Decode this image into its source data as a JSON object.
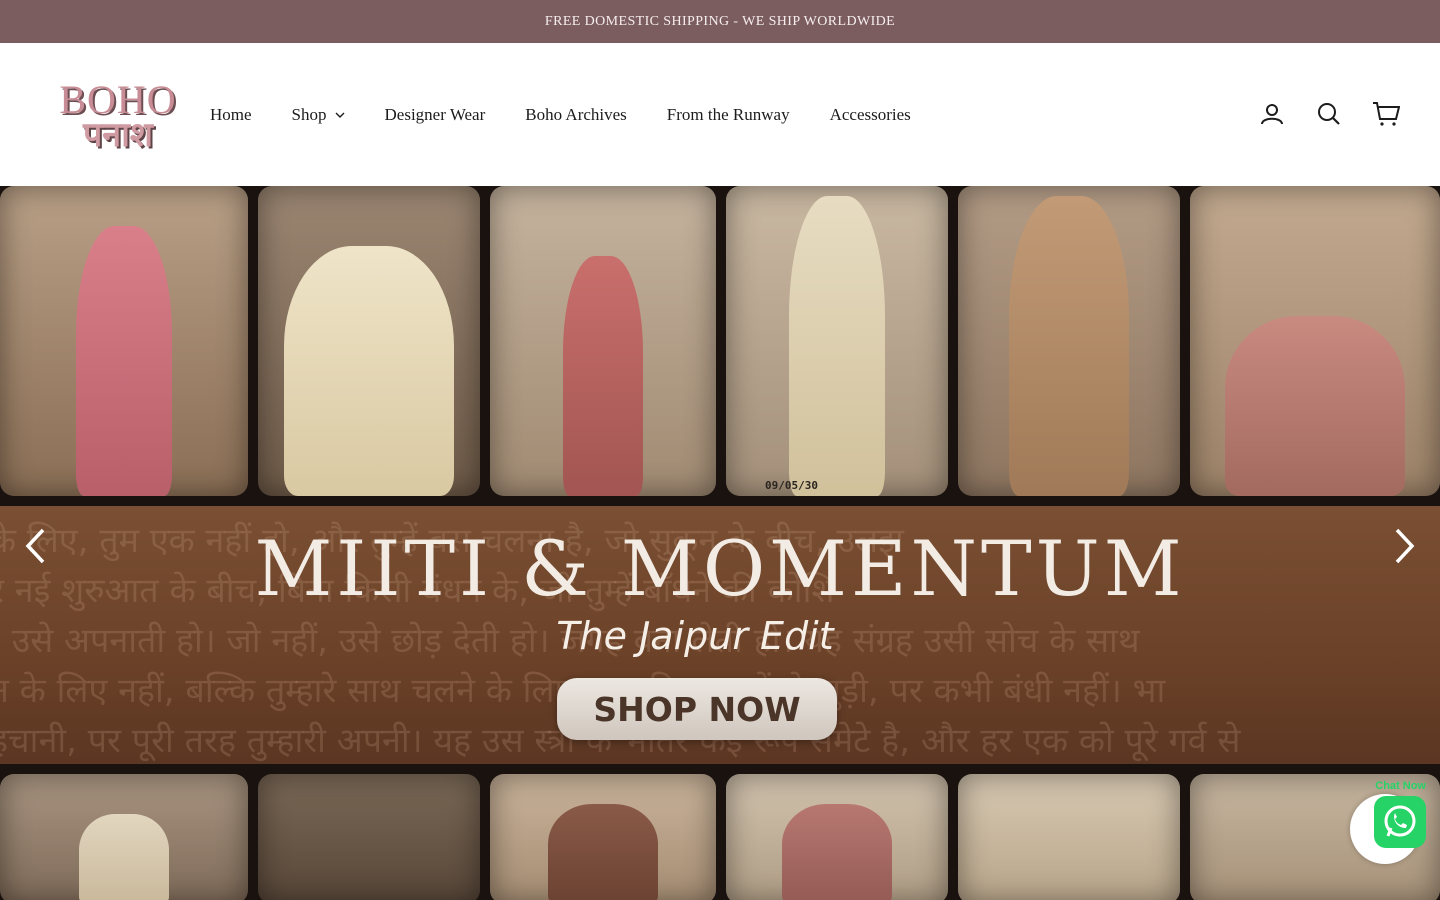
{
  "announcement": "FREE DOMESTIC SHIPPING - WE SHIP WORLDWIDE",
  "brand": {
    "line1": "BOHO",
    "line2": "पनाश"
  },
  "nav": {
    "items": [
      {
        "label": "Home"
      },
      {
        "label": "Shop"
      },
      {
        "label": "Designer Wear"
      },
      {
        "label": "Boho Archives"
      },
      {
        "label": "From the Runway"
      },
      {
        "label": "Accessories"
      }
    ]
  },
  "icons": {
    "account": "account-icon",
    "search": "search-icon",
    "cart": "cart-icon"
  },
  "hero": {
    "headline": "MIITI & MOMENTUM",
    "subheadline": "The Jaipur Edit",
    "cta": "SHOP NOW",
    "date_stamp": "09/05/30",
    "background_text": [
      "के लिए, तुम एक नहीं हो, और तुम्हें बस चलना है, जो सुकून के बीच, उलझ",
      "र नई शुरुआत के बीच, बिना किसी बंधन के, जो तुम्हें बाँधने की कोशि",
      ", उसे अपनाती हो। जो नहीं, उसे छोड़ देती हो। जगह बना लेती हो। यह संग्रह उसी सोच के साथ",
      "न के लिए नहीं, बल्कि तुम्हारे साथ चलने के लिए। उस दिन। जड़ों से जुड़ी, पर कभी बंधी नहीं। भा",
      "हचानी, पर पूरी तरह तुम्हारी अपनी। यह उस स्त्री के भीतर कई रूप समेटे है, और हर एक को पूरे गर्व से"
    ]
  },
  "chat": {
    "label": "Chat Now"
  },
  "colors": {
    "announcement_bg": "#7b5c5f",
    "brand_pink": "#c78c95",
    "hero_band": "#6b4128",
    "whatsapp": "#25d366"
  }
}
